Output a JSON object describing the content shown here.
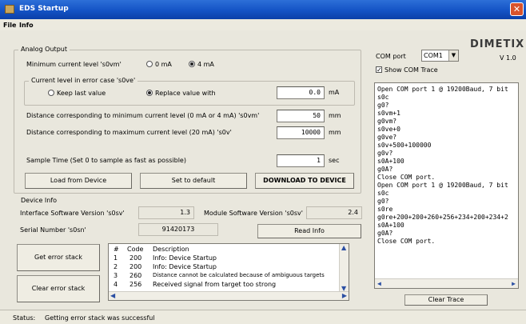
{
  "window": {
    "title": "EDS Startup",
    "close": "✕"
  },
  "menu": {
    "file": "File",
    "info": "Info"
  },
  "analog_output": {
    "group_label": "Analog Output",
    "min_current_label": "Minimum current level 's0vm'",
    "opt_0ma": "0 mA",
    "opt_4ma": "4 mA",
    "selected_min": "4 mA",
    "error_group_label": "Current level in error case 's0ve'",
    "opt_keep": "Keep last value",
    "opt_replace": "Replace value with",
    "selected_error": "Replace value with",
    "replace_value": "0.0",
    "replace_unit": "mA",
    "dist_min_label": "Distance corresponding to minimum current level (0 mA or 4 mA) 's0vm'",
    "dist_min_value": "50",
    "dist_min_unit": "mm",
    "dist_max_label": "Distance corresponding to maximum current level (20 mA) 's0v'",
    "dist_max_value": "10000",
    "dist_max_unit": "mm",
    "sample_label": "Sample Time (Set 0 to sample as fast as possible)",
    "sample_value": "1",
    "sample_unit": "sec",
    "btn_load": "Load from Device",
    "btn_default": "Set to default",
    "btn_download": "DOWNLOAD TO DEVICE"
  },
  "device_info": {
    "group_label": "Device Info",
    "iface_label": "Interface Software Version 's0sv'",
    "iface_value": "1.3",
    "module_label": "Module Software Version 's0sv'",
    "module_value": "2.4",
    "serial_label": "Serial Number 's0sn'",
    "serial_value": "91420173",
    "btn_read": "Read Info"
  },
  "error_stack": {
    "btn_get": "Get error stack",
    "btn_clear": "Clear error stack",
    "headers": {
      "num": "#",
      "code": "Code",
      "desc": "Description"
    },
    "rows": [
      {
        "num": "1",
        "code": "200",
        "desc": "Info: Device Startup"
      },
      {
        "num": "2",
        "code": "200",
        "desc": "Info: Device Startup"
      },
      {
        "num": "3",
        "code": "260",
        "desc": "Distance cannot be calculated because of ambiguous targets"
      },
      {
        "num": "4",
        "code": "256",
        "desc": "Received signal from target too strong"
      }
    ]
  },
  "com": {
    "port_label": "COM port",
    "port_value": "COM1",
    "show_trace_label": "Show COM Trace",
    "show_trace_checked": true,
    "brand": "DIMETIX",
    "version": "V 1.0",
    "trace_lines": [
      "Open COM port 1 @ 19200Baud, 7 bit",
      "s0c",
      "g0?",
      "s0vm+1",
      "g0vm?",
      "s0ve+0",
      "g0ve?",
      "s0v+500+100000",
      "g0v?",
      "s0A+100",
      "g0A?",
      "Close COM port.",
      "Open COM port 1 @ 19200Baud, 7 bit",
      "s0c",
      "g0?",
      "s0re",
      "g0re+200+200+260+256+234+200+234+2",
      "s0A+100",
      "g0A?",
      "Close COM port."
    ],
    "btn_clear_trace": "Clear Trace"
  },
  "status": {
    "label": "Status:",
    "text": "Getting error stack was successful"
  },
  "colors": {
    "title_bar": "#1453c5",
    "brand": "#3a3a3a",
    "close": "#d8532c"
  }
}
